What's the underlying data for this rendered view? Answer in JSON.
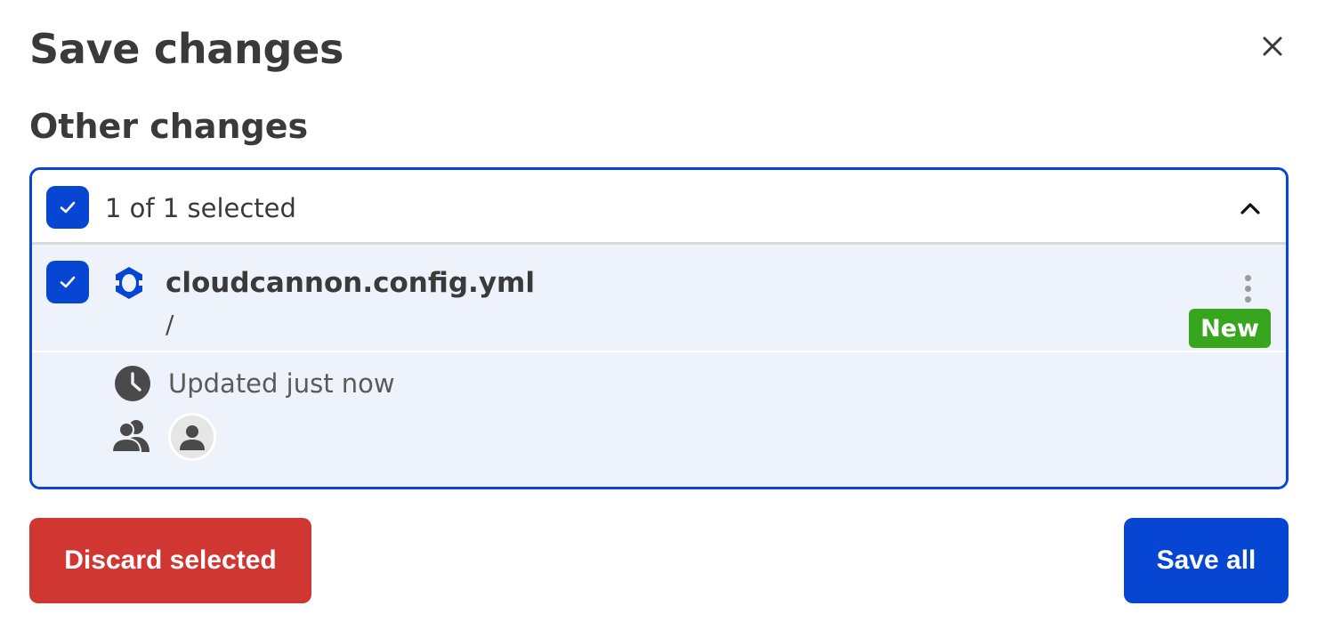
{
  "dialog": {
    "title": "Save changes",
    "section_title": "Other changes"
  },
  "selection": {
    "summary": "1 of 1 selected"
  },
  "file": {
    "name": "cloudcannon.config.yml",
    "path": "/",
    "badge": "New",
    "updated": "Updated just now"
  },
  "actions": {
    "discard_label": "Discard selected",
    "save_label": "Save all"
  },
  "colors": {
    "primary": "#0646d3",
    "danger": "#d03632",
    "success": "#38a51e",
    "item_background": "#eef2fb"
  },
  "icons": {
    "close": "close-icon",
    "checkbox": "check-icon",
    "collapse": "chevron-up-icon",
    "file": "cloudcannon-logo-icon",
    "menu": "kebab-menu-icon",
    "time": "clock-icon",
    "people": "users-icon",
    "avatar": "user-avatar-icon"
  }
}
